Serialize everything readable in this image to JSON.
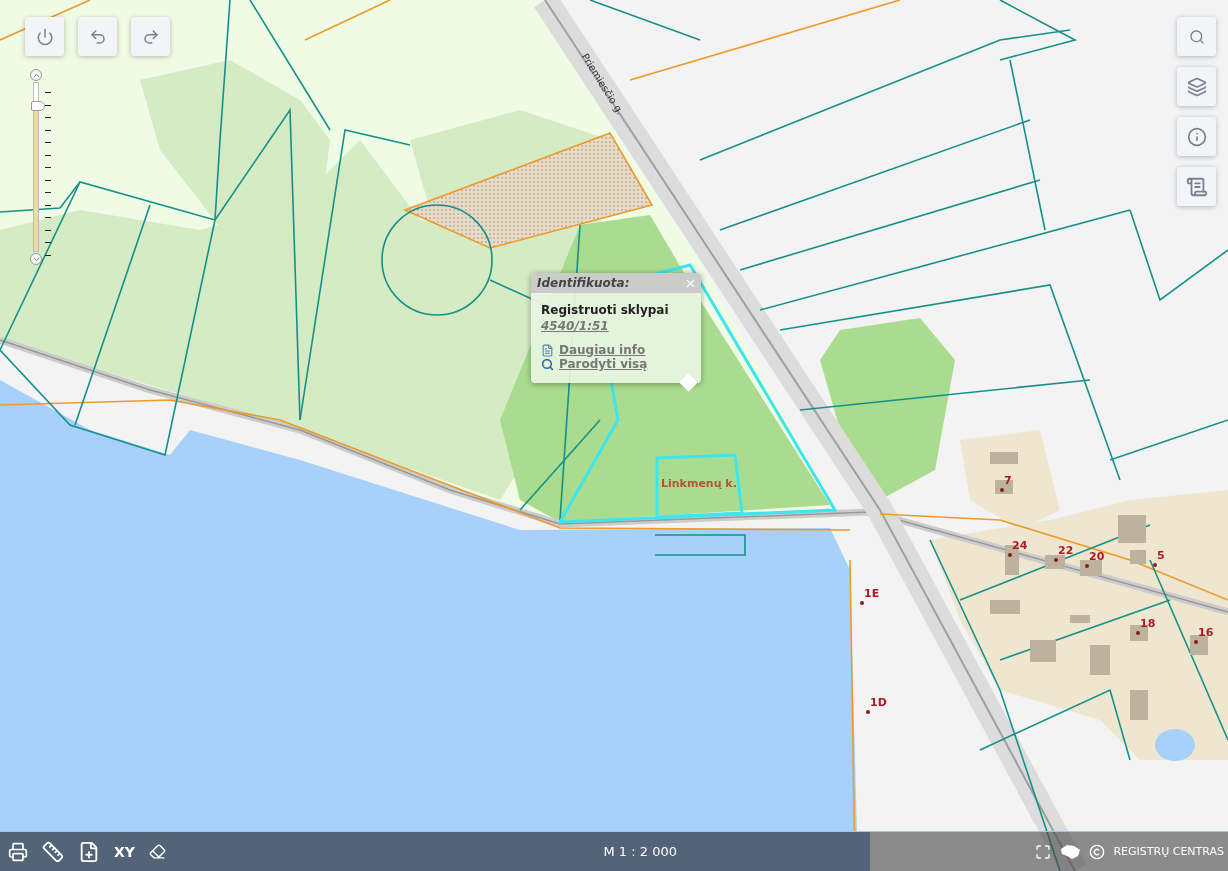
{
  "map": {
    "street_label": "Priemiesčio g.",
    "place_label": "Linkmenų k.",
    "house_numbers": [
      {
        "label": "7"
      },
      {
        "label": "24"
      },
      {
        "label": "22"
      },
      {
        "label": "20"
      },
      {
        "label": "5"
      },
      {
        "label": "18"
      },
      {
        "label": "16"
      },
      {
        "label": "1E"
      },
      {
        "label": "1D"
      }
    ]
  },
  "top_controls": [
    {
      "kind": "power"
    },
    {
      "kind": "back"
    },
    {
      "kind": "forward"
    }
  ],
  "zoom_slider": {
    "level": 0.87
  },
  "popup": {
    "title": "Identifikuota:",
    "layer": "Registruoti sklypai",
    "parcel_id": "4540/1:51",
    "links": [
      {
        "kind": "info",
        "label": "Daugiau info"
      },
      {
        "kind": "zoom",
        "label": "Parodyti visą"
      }
    ]
  },
  "right_tools": [
    {
      "kind": "search"
    },
    {
      "kind": "layers"
    },
    {
      "kind": "info"
    },
    {
      "kind": "legend"
    }
  ],
  "bottom_bar": {
    "tools": [
      {
        "kind": "print"
      },
      {
        "kind": "measure"
      },
      {
        "kind": "add-document"
      },
      {
        "kind": "coordinates",
        "label": "XY"
      },
      {
        "kind": "erase"
      }
    ],
    "scale": "M 1 : 2 000",
    "credit": "REGISTRŲ CENTRAS"
  }
}
